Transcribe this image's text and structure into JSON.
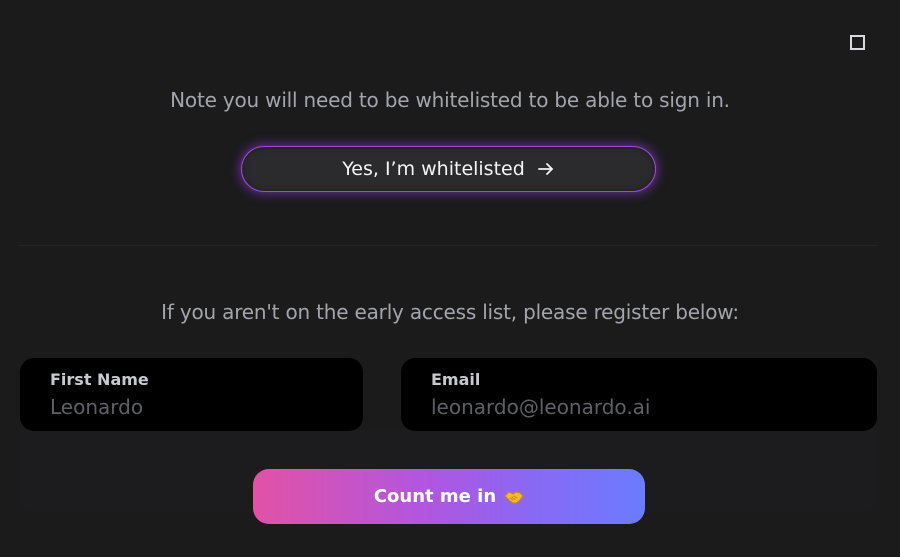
{
  "header": {
    "close_icon": "square-outline-icon"
  },
  "signin": {
    "note": "Note you will need to be whitelisted to be able to sign in.",
    "button_label": "Yes, I’m whitelisted",
    "button_icon": "arrow-right-icon",
    "accent_color": "#9b4ad8"
  },
  "register": {
    "note": "If you aren't on the early access list, please register below:",
    "first_name": {
      "label": "First Name",
      "placeholder": "Leonardo",
      "value": ""
    },
    "email": {
      "label": "Email",
      "placeholder": "leonardo@leonardo.ai",
      "value": ""
    },
    "submit_label": "Count me in",
    "submit_icon": "handshake-icon",
    "gradient_colors": [
      "#e252a6",
      "#b056e0",
      "#6a7cff"
    ]
  }
}
